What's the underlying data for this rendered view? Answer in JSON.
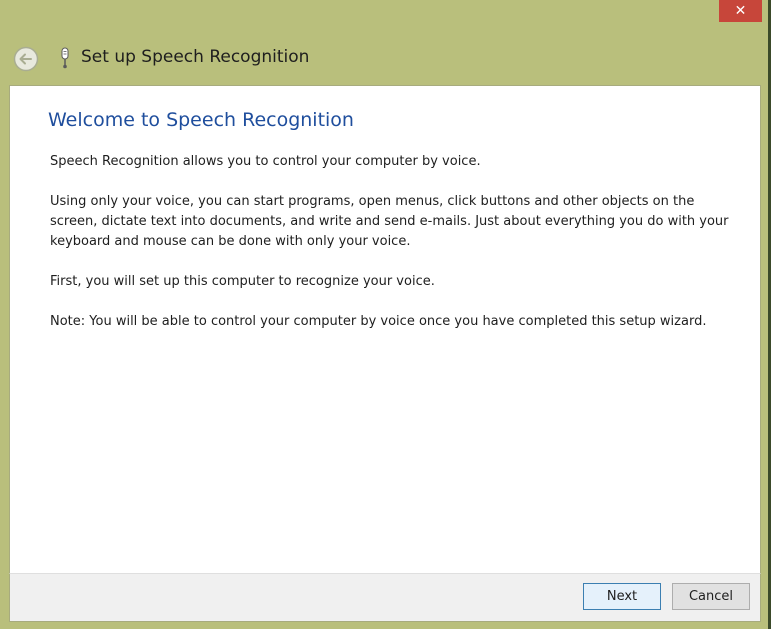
{
  "titlebar": {
    "close_glyph": "✕",
    "title": "Set up Speech Recognition"
  },
  "icons": {
    "back": "back-arrow-icon",
    "mic": "microphone-icon",
    "close": "close-icon"
  },
  "content": {
    "heading": "Welcome to Speech Recognition",
    "paragraphs": [
      "Speech Recognition allows you to control your computer by voice.",
      "Using only your voice, you can start programs, open menus, click buttons and other objects on the screen, dictate text into documents, and write and send e-mails. Just about everything you do with your keyboard and mouse can be done with only your voice.",
      "First, you will set up this computer to recognize your voice.",
      "Note: You will be able to control your computer by voice once you have completed this setup wizard."
    ]
  },
  "footer": {
    "next_label": "Next",
    "cancel_label": "Cancel"
  },
  "colors": {
    "frame": "#b9bf7c",
    "close_button": "#c7463a",
    "heading": "#1f4e9d",
    "default_button_border": "#3c7fb1"
  }
}
